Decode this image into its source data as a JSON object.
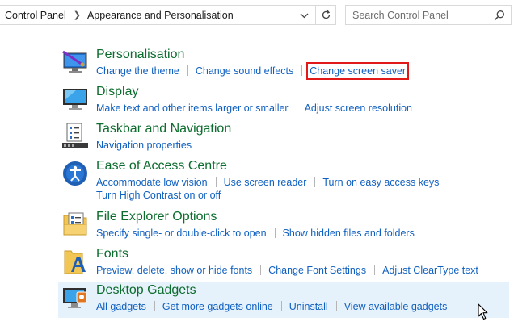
{
  "address_bar": {
    "crumbs": [
      "Control Panel",
      "Appearance and Personalisation"
    ]
  },
  "search": {
    "placeholder": "Search Control Panel"
  },
  "categories": [
    {
      "title": "Personalisation",
      "icon": "personalisation-icon",
      "links": [
        [
          "Change the theme",
          "Change sound effects",
          "Change screen saver"
        ]
      ],
      "highlighted_link": "Change screen saver"
    },
    {
      "title": "Display",
      "icon": "display-icon",
      "links": [
        [
          "Make text and other items larger or smaller",
          "Adjust screen resolution"
        ]
      ]
    },
    {
      "title": "Taskbar and Navigation",
      "icon": "taskbar-icon",
      "links": [
        [
          "Navigation properties"
        ]
      ]
    },
    {
      "title": "Ease of Access Centre",
      "icon": "ease-of-access-icon",
      "links": [
        [
          "Accommodate low vision",
          "Use screen reader",
          "Turn on easy access keys"
        ],
        [
          "Turn High Contrast on or off"
        ]
      ]
    },
    {
      "title": "File Explorer Options",
      "icon": "file-explorer-options-icon",
      "links": [
        [
          "Specify single- or double-click to open",
          "Show hidden files and folders"
        ]
      ]
    },
    {
      "title": "Fonts",
      "icon": "fonts-icon",
      "links": [
        [
          "Preview, delete, show or hide fonts",
          "Change Font Settings",
          "Adjust ClearType text"
        ]
      ]
    },
    {
      "title": "Desktop Gadgets",
      "icon": "desktop-gadgets-icon",
      "links": [
        [
          "All gadgets",
          "Get more gadgets online",
          "Uninstall",
          "View available gadgets"
        ]
      ],
      "hovered": true
    }
  ],
  "colors": {
    "title": "#0c6c2d",
    "link": "#1060c0",
    "hover_bg": "#e5f1fb",
    "highlight_box": "#e11919"
  }
}
